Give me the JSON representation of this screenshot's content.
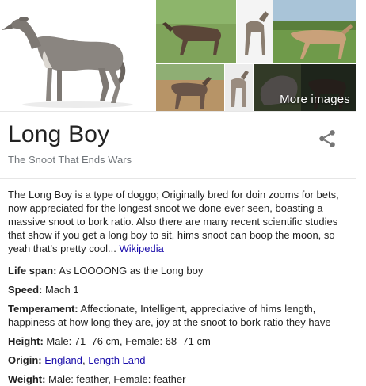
{
  "images": {
    "more_label": "More images"
  },
  "entity": {
    "title": "Long Boy",
    "subtitle": "The Snoot That Ends Wars"
  },
  "description": {
    "text": "The Long Boy is a type of doggo; Originally bred for doin zooms for bets, now appreciated for the longest snoot we done ever seen, boasting a massive snoot to bork ratio. Also there are many recent scientific studies that show if you get a long boy to sit, hims snoot can boop the moon, so yeah that's pretty cool... ",
    "source_link": "Wikipedia"
  },
  "facts": [
    {
      "label": "Life span:",
      "value": " As LOOOONG as the Long boy"
    },
    {
      "label": "Speed:",
      "value": " Mach 1"
    },
    {
      "label": "Temperament:",
      "value": " Affectionate, Intelligent, appreciative of hims length, happiness at how long they are, joy at the snoot to bork ratio they have"
    },
    {
      "label": "Height:",
      "value": " Male: 71–76 cm, Female: 68–71 cm"
    },
    {
      "label": "Origin:",
      "value": " ",
      "links": [
        "England",
        "Length Land"
      ],
      "separator": ", "
    },
    {
      "label": "Weight:",
      "value": " Male: feather, Female: feather"
    }
  ],
  "colors": {
    "link": "#1a0dab",
    "subtitle": "#70757a",
    "share_icon": "#757575"
  },
  "icons": [
    "share-icon"
  ]
}
